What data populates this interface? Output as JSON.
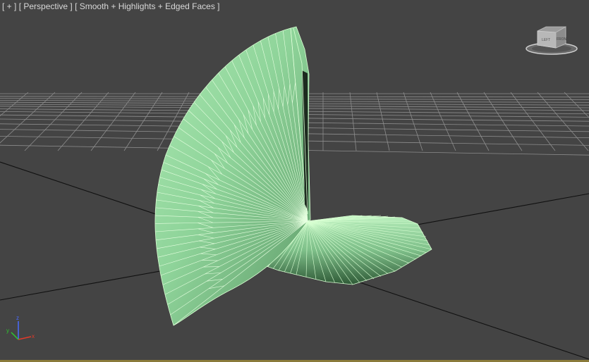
{
  "viewport": {
    "label": {
      "plus": "[ + ]",
      "view": "[ Perspective ]",
      "shading": "[ Smooth + Highlights + Edged Faces ]"
    },
    "viewcube": {
      "icon": "viewcube-icon",
      "face_left": "LEFT",
      "face_front": "FRONT"
    },
    "axis_tripod": {
      "x": "x",
      "y": "y",
      "z": "z",
      "colors": {
        "x": "#e23a2a",
        "y": "#2ec82e",
        "z": "#4a6bff"
      }
    },
    "object": {
      "fill": "#8fd49a",
      "edge": "#d8ffd2",
      "shadow": "#2e5436"
    },
    "grid_color": "#9a9a9a",
    "background": "#444444"
  }
}
